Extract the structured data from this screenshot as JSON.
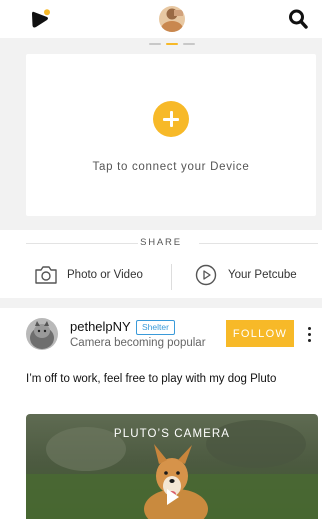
{
  "header": {
    "logo_icon": "petcube-logo-icon",
    "avatar_icon": "user-avatar-icon",
    "search_icon": "search-icon",
    "accent": "#f7b928"
  },
  "page_indicator": {
    "count": 3,
    "active_index": 1
  },
  "device": {
    "add_icon": "plus-icon",
    "label": "Tap to connect your Device"
  },
  "share": {
    "title": "SHARE",
    "photo_label": "Photo or Video",
    "photo_icon": "camera-icon",
    "petcube_label": "Your Petcube",
    "petcube_icon": "play-circle-icon"
  },
  "post": {
    "username": "pethelpNY",
    "badge": "Shelter",
    "subtitle": "Camera becoming popular",
    "follow_label": "FOLLOW",
    "menu_icon": "more-vertical-icon",
    "text": "I’m off to work, feel free to play with my dog Pluto",
    "video_title": "PLUTO’S CAMERA",
    "play_icon": "play-icon",
    "badge_color": "#3a9ad9"
  }
}
